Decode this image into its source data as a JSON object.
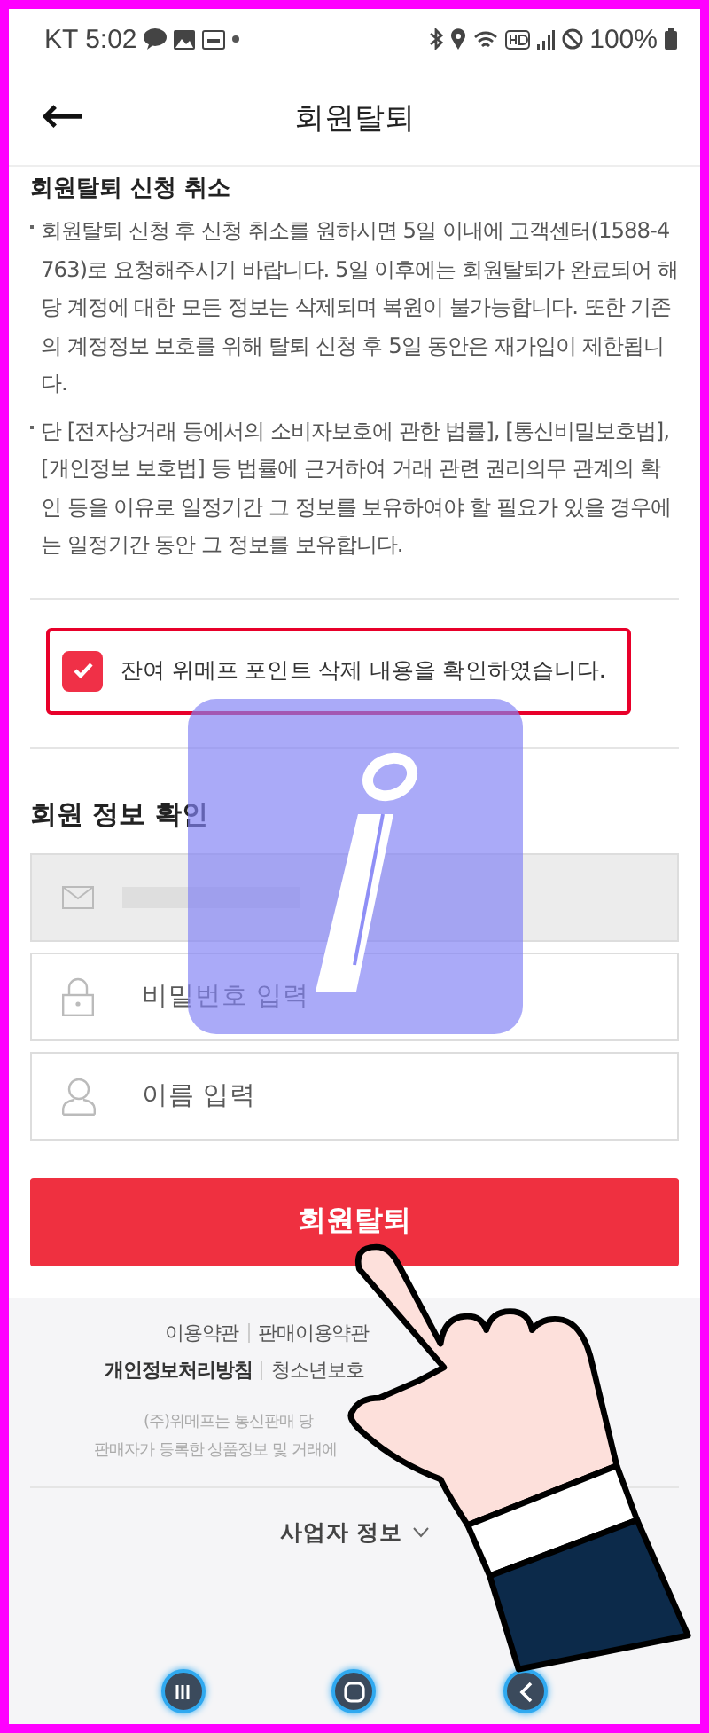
{
  "status_bar": {
    "carrier_time": "KT 5:02",
    "battery": "100%"
  },
  "header": {
    "back": "←",
    "title": "회원탈퇴"
  },
  "notice": {
    "heading": "회원탈퇴 신청 취소",
    "items": [
      "회원탈퇴 신청 후 신청 취소를 원하시면 5일 이내에 고객센터(1588-4763)로 요청해주시기 바랍니다. 5일 이후에는 회원탈퇴가 완료되어 해당 계정에 대한 모든 정보는 삭제되며 복원이 불가능합니다. 또한 기존의 계정정보 보호를 위해 탈퇴 신청 후 5일 동안은 재가입이 제한됩니다.",
      "단 [전자상거래 등에서의 소비자보호에 관한 법률], [통신비밀보호법], [개인정보 보호법] 등 법률에 근거하여 거래 관련 권리의무 관계의 확인 등을 이유로 일정기간 그 정보를 보유하여야 할 필요가 있을 경우에는 일정기간 동안 그 정보를 보유합니다."
    ]
  },
  "confirm": {
    "label": "잔여 위메프 포인트 삭제 내용을 확인하였습니다.",
    "checked": true
  },
  "member_info": {
    "heading": "회원 정보 확인",
    "fields": [
      {
        "kind": "email",
        "disabled": true
      },
      {
        "kind": "password",
        "placeholder": "비밀번호 입력",
        "disabled": false
      },
      {
        "kind": "name",
        "placeholder": "이름 입력",
        "disabled": false
      }
    ]
  },
  "submit_button": "회원탈퇴",
  "footer": {
    "links_row1": [
      {
        "label": "이용약관",
        "bold": false
      },
      {
        "label": "판매이용약관",
        "bold": false
      }
    ],
    "links_row2": [
      {
        "label": "개인정보처리방침",
        "bold": true
      },
      {
        "label": "청소년보호",
        "bold": false
      }
    ],
    "disclaimer": [
      "(주)위메프는 통신판매 당",
      "판매자가 등록한 상품정보 및 거래에 "
    ],
    "business_info": "사업자 정보"
  }
}
